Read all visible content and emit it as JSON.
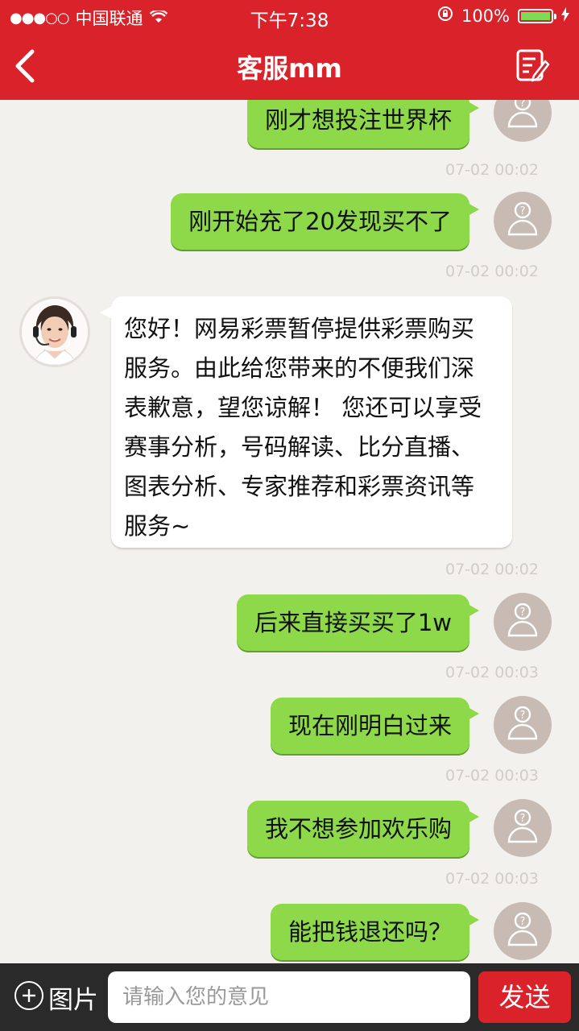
{
  "status_bar": {
    "signal_dots": "●●●○○",
    "carrier": "中国联通",
    "time": "下午7:38",
    "battery_pct": "100%"
  },
  "nav": {
    "title": "客服mm",
    "back_icon": "chevron-left-icon",
    "edit_icon": "edit-note-icon"
  },
  "messages": [
    {
      "text": "刚才想投注世界杯",
      "time": "07-02 00:02"
    },
    {
      "text": "刚开始充了20发现买不了",
      "time": "07-02 00:02"
    },
    {
      "lines": [
        "您好！网易彩票暂停提供彩票购买",
        "服务。由此给您带来的不便我们深",
        "表歉意，望您谅解！ 您还可以享受",
        "赛事分析，号码解读、比分直播、",
        "图表分析、专家推荐和彩票资讯等",
        "服务~"
      ],
      "time": "07-02 00:02"
    },
    {
      "text": "后来直接买买了1w",
      "time": "07-02 00:03"
    },
    {
      "text": "现在刚明白过来",
      "time": "07-02 00:03"
    },
    {
      "text": "我不想参加欢乐购",
      "time": "07-02 00:03"
    },
    {
      "text": "能把钱退还吗？"
    }
  ],
  "input_bar": {
    "image_label": "图片",
    "placeholder": "请输入您的意见",
    "send_label": "发送"
  },
  "colors": {
    "brand_red": "#d9222a",
    "bubble_green": "#8ed94a",
    "chat_bg": "#f3f1ee"
  }
}
